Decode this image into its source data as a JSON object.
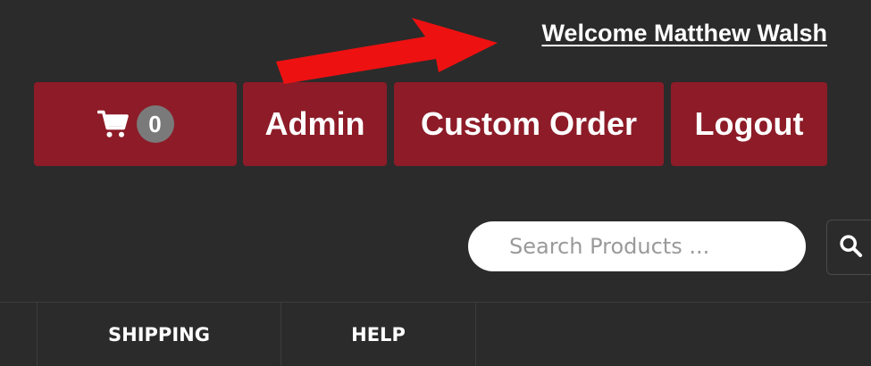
{
  "header": {
    "welcome_text": "Welcome Matthew Walsh"
  },
  "actions": {
    "cart_count": "0",
    "admin_label": "Admin",
    "custom_order_label": "Custom Order",
    "logout_label": "Logout"
  },
  "search": {
    "placeholder": "Search Products ...",
    "value": ""
  },
  "nav": {
    "items": [
      {
        "label": "SHIPPING"
      },
      {
        "label": "HELP"
      }
    ]
  },
  "icons": {
    "cart": "cart-icon",
    "search": "search-icon",
    "annotation": "red-arrow-icon"
  },
  "colors": {
    "background": "#2b2b2b",
    "button": "#8d1c28",
    "badge": "#7a7a7a",
    "text": "#ffffff",
    "arrow": "#ee1111"
  }
}
